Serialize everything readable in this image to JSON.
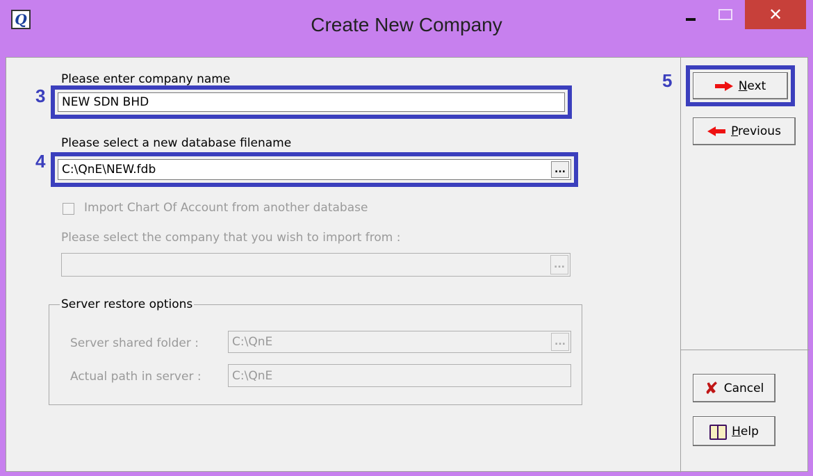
{
  "window": {
    "app_icon_letter": "Q",
    "title": "Create New Company",
    "close_glyph": "✕"
  },
  "form": {
    "company_name_label": "Please enter company name",
    "company_name_value": "NEW SDN BHD",
    "db_filename_label": "Please select a new database filename",
    "db_filename_value": "C:\\QnE\\NEW.fdb",
    "browse_label": "...",
    "import_coa_label": "Import Chart Of Account from another database",
    "import_coa_checked": false,
    "import_company_label": "Please select the company that you wish to import from :",
    "import_company_value": ""
  },
  "server_restore": {
    "group_title": "Server restore options",
    "shared_folder_label": "Server shared folder :",
    "shared_folder_value": "C:\\QnE",
    "actual_path_label": "Actual path in server :",
    "actual_path_value": "C:\\QnE"
  },
  "annotations": {
    "step_3": "3",
    "step_4": "4",
    "step_5": "5",
    "highlight_color": "#3b3fbd"
  },
  "buttons": {
    "next_mnemonic": "N",
    "next_rest": "ext",
    "previous_mnemonic": "P",
    "previous_rest": "revious",
    "cancel": "Cancel",
    "help_mnemonic": "H",
    "help_rest": "elp"
  },
  "icons": {
    "next": "arrow-right-icon",
    "previous": "arrow-left-icon",
    "cancel": "x-icon",
    "help": "book-icon"
  },
  "colors": {
    "titlebar": "#c780ee",
    "close_button": "#c7403a"
  }
}
